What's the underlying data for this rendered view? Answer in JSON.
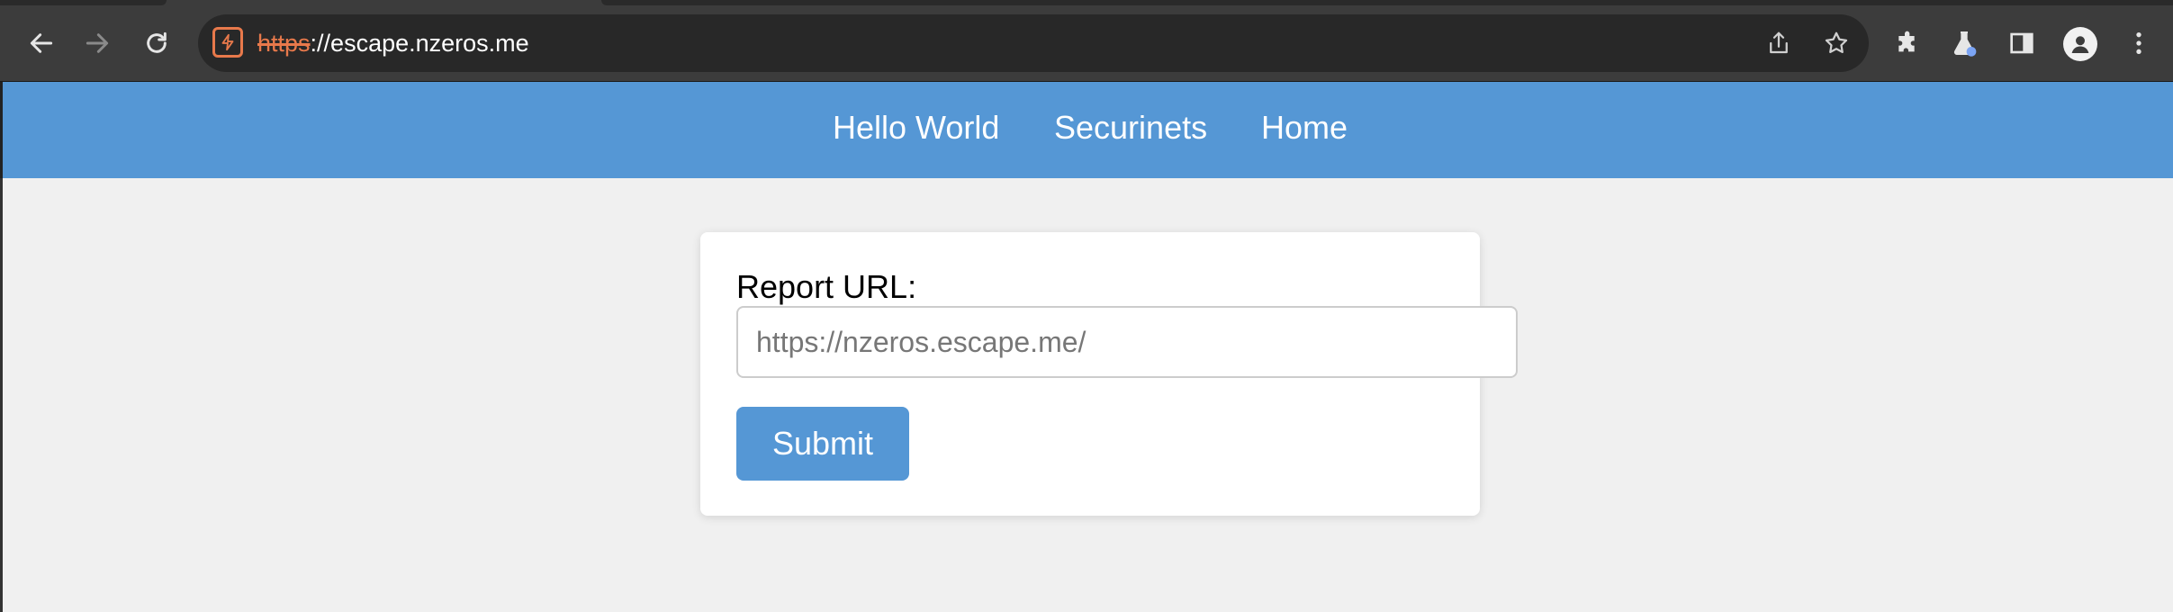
{
  "browser": {
    "url_scheme": "https",
    "url_rest": "://escape.nzeros.me",
    "icons": {
      "back": "arrow-left-icon",
      "forward": "arrow-right-icon",
      "reload": "reload-icon",
      "site_security": "not-secure-warning-icon",
      "share": "share-icon",
      "bookmark": "star-icon",
      "extensions": "puzzle-icon",
      "labs": "flask-icon",
      "side_panel": "side-panel-icon",
      "profile": "person-icon",
      "menu": "kebab-menu-icon"
    },
    "colors": {
      "frame": "#3c3c3c",
      "omnibox": "#282828",
      "warning": "#e8794b"
    }
  },
  "nav": {
    "links": [
      "Hello World",
      "Securinets",
      "Home"
    ],
    "color": "#5597d5"
  },
  "form": {
    "label": "Report URL:",
    "input_placeholder": "https://nzeros.escape.me/",
    "input_value": "",
    "submit_label": "Submit"
  }
}
